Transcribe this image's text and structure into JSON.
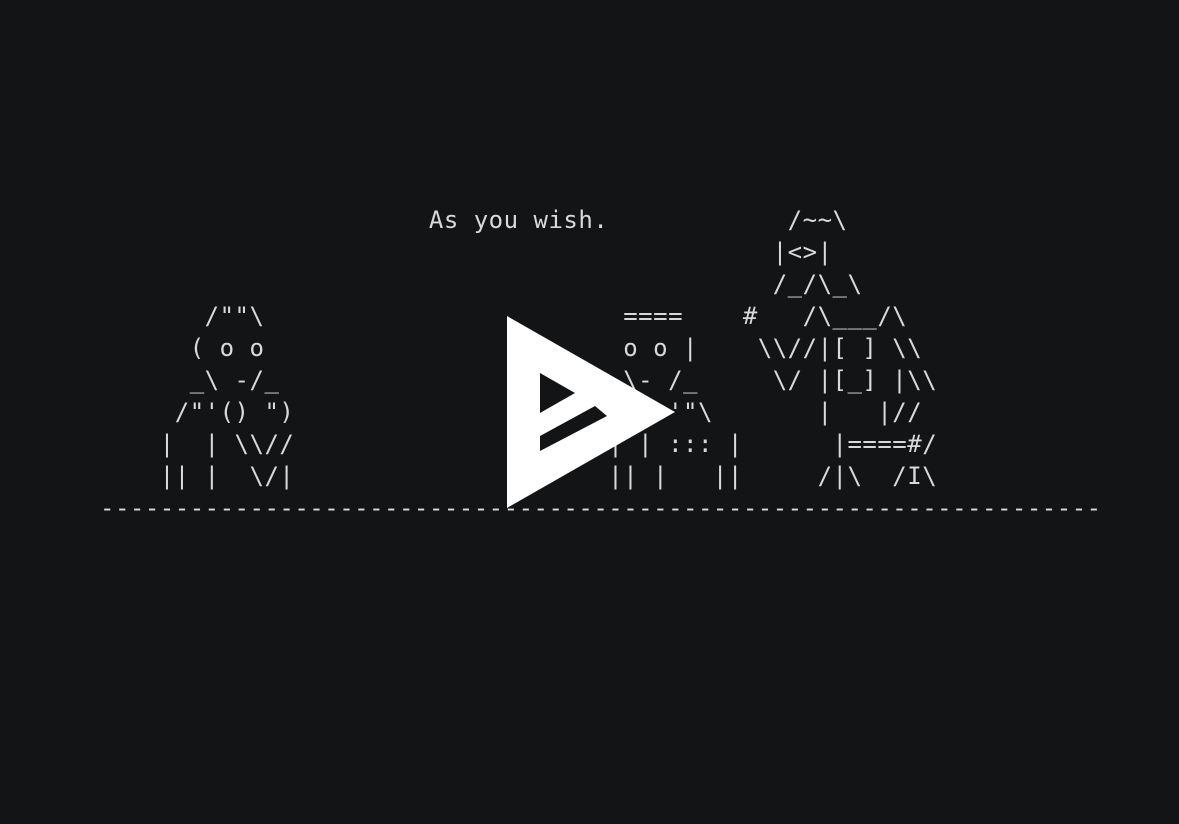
{
  "player": {
    "background_color": "#131416",
    "text_color": "#d9d9d9",
    "frame_lines": [
      "                      As you wish.            /~~\\",
      "                                             |<>|",
      "                                             /_/\\_\\",
      "       /\"\"\\                        ====    #   /\\___/\\",
      "      ( o o                        o o |    \\\\//|[ ] \\\\",
      "      _\\ -/_                       \\- /_     \\/ |[_] |\\\\",
      "     /\"'() \")                     /\"=='\"\\       |   |//",
      "    |  | \\\\//                     | | ::: |      |====#/",
      "    || |  \\/|                     || |   ||     /|\\  /I\\",
      "-------------------------------------------------------------------"
    ],
    "play_button": {
      "icon": "play-icon",
      "color": "#ffffff"
    }
  }
}
